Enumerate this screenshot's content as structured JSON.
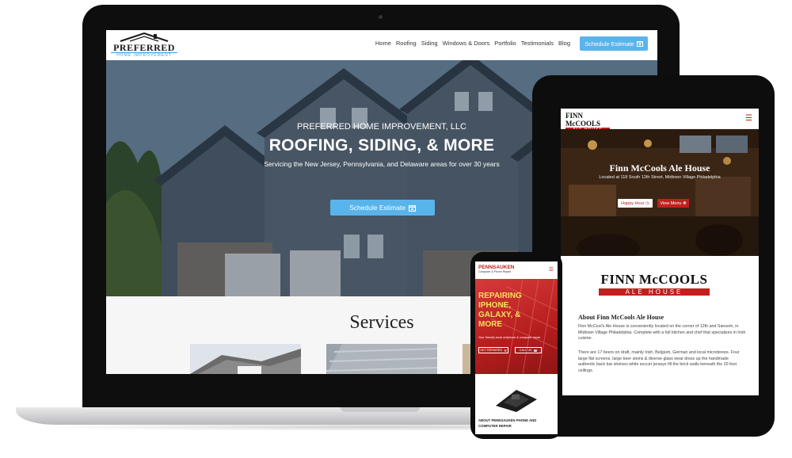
{
  "laptop": {
    "nav": {
      "logo_main": "PREFERRED",
      "logo_sub": "HOME IMPROVEMENT",
      "menu": [
        "Home",
        "Roofing",
        "Siding",
        "Windows & Doors",
        "Portfolio",
        "Testimonials",
        "Blog"
      ],
      "cta_label": "Schedule Estimate"
    },
    "hero": {
      "eyebrow": "PREFERRED HOME IMPROVEMENT, LLC",
      "title": "ROOFING, SIDING, & MORE",
      "subtitle": "Servicing the New Jersey, Pennsylvania, and Delaware areas for over 30 years",
      "button_label": "Schedule Estimate"
    },
    "services": {
      "title": "Services"
    }
  },
  "tablet": {
    "header": {
      "logo_main": "FINN McCOOLS",
      "logo_sub": "ALE HOUSE"
    },
    "hero": {
      "title": "Finn McCools Ale House",
      "subtitle": "Located at 118 South 12th Street, Midtown Village Philadelphia",
      "button_1": "Happy Hour",
      "button_2": "View Menu"
    },
    "logo_large": {
      "main": "FINN McCOOLS",
      "sub": "ALE HOUSE"
    },
    "about": {
      "title": "About Finn McCools Ale House",
      "paragraph_1": "Finn McCool's Ale House is conveniently located on the corner of 12th and Sansom, in Midtown Village Philadelphia. Complete with a full kitchen and chef that specializes in Irish cuisine.",
      "paragraph_2": "There are 17 beers on draft, mainly Irish, Belgium, German and local microbrews. Four large flat screens, large beer steins & diverse glass wear dress up the handmade authentic back bar shelves while soccer jerseys fill the brick walls beneath the 20 foot ceilings."
    }
  },
  "phone": {
    "header": {
      "logo_main": "PENNSAUKEN",
      "logo_sub": "Computer & Phone Repair"
    },
    "hero": {
      "title": "REPAIRING IPHONE, GALAXY, & MORE",
      "subtitle": "Your friendly local cellphone & computer repair",
      "button_1": "GET REPAIRED",
      "button_2": "CALL US"
    },
    "about_title": "ABOUT PENNSAUKEN PHONE AND COMPUTER REPAIR"
  },
  "colors": {
    "accent_blue": "#5ab4ec",
    "brand_red": "#c0201e",
    "hero_yellow": "#f6e25c"
  }
}
